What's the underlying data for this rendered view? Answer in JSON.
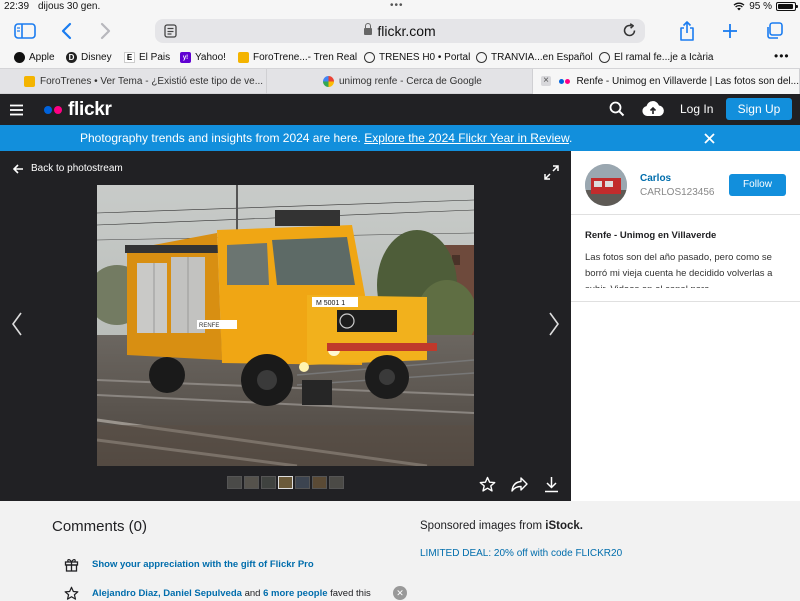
{
  "status_bar": {
    "time": "22:39",
    "date": "dijous 30 gen.",
    "dots": "•••",
    "battery": "95 %",
    "battery_level": 0.95
  },
  "browser": {
    "url": "flickr.com",
    "bookmarks": [
      {
        "label": "Apple",
        "icon": "apple-icon"
      },
      {
        "label": "Disney",
        "icon": "disney-icon"
      },
      {
        "label": "El Pais",
        "icon": "elpais-icon",
        "glyph": "E"
      },
      {
        "label": "Yahoo!",
        "icon": "yahoo-icon",
        "glyph": "y!"
      },
      {
        "label": "ForoTrene...- Tren Real",
        "icon": "forotrenes-icon"
      },
      {
        "label": "TRENES H0 • Portal",
        "icon": "globe-icon"
      },
      {
        "label": "TRANVIA...en Español",
        "icon": "globe-icon"
      },
      {
        "label": "El ramal fe...je a Icària",
        "icon": "globe-icon"
      }
    ],
    "tabs": [
      {
        "label": "ForoTrenes • Ver Tema - ¿Existió este tipo de ve...",
        "active": false
      },
      {
        "label": "unimog renfe - Cerca de Google",
        "active": false
      },
      {
        "label": "Renfe - Unimog en Villaverde | Las fotos son del...",
        "active": true
      }
    ]
  },
  "flickr_header": {
    "logo_text": "flickr",
    "login": "Log In",
    "signup": "Sign Up"
  },
  "banner": {
    "text": "Photography trends and insights from 2024 are here. ",
    "link": "Explore the 2024 Flickr Year in Review",
    "suffix": "."
  },
  "photo": {
    "back_label": "Back to photostream",
    "thumbnail_count": 7
  },
  "owner": {
    "name": "Carlos",
    "username": "CARLOS123456",
    "follow_label": "Follow"
  },
  "photo_info": {
    "title": "Renfe - Unimog en Villaverde",
    "description": "Las fotos son del año pasado, pero como se borró mi vieja cuenta he decidido volverlas a subir. Videos en el canal para..."
  },
  "comments": {
    "heading": "Comments (0)",
    "pro_gift": "Show your appreciation with the gift of Flickr Pro",
    "fave_names": "Alejandro Diaz, Daniel Sepulveda",
    "fave_and": " and ",
    "fave_more": "6 more people",
    "fave_suffix": " faved this"
  },
  "sponsored": {
    "label": "Sponsored images from ",
    "brand": "iStock.",
    "deal": "LIMITED DEAL: 20% off with code FLICKR20"
  },
  "colors": {
    "flickr_blue": "#128fdc",
    "flickr_pink": "#ff0084",
    "flickr_blue_dot": "#0063dc",
    "link_blue": "#006dac",
    "dark_bg": "#212124"
  }
}
